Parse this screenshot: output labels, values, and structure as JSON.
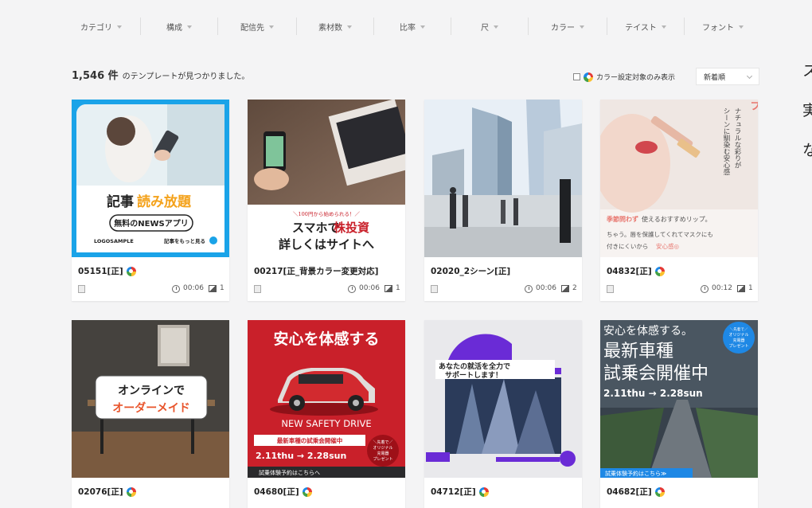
{
  "filters": [
    {
      "label": "カテゴリ"
    },
    {
      "label": "構成"
    },
    {
      "label": "配信先"
    },
    {
      "label": "素材数"
    },
    {
      "label": "比率"
    },
    {
      "label": "尺"
    },
    {
      "label": "カラー"
    },
    {
      "label": "テイスト"
    },
    {
      "label": "フォント"
    }
  ],
  "results": {
    "count": "1,546 件",
    "suffix": "のテンプレートが見つかりました。"
  },
  "color_filter": {
    "label": "カラー設定対象のみ表示",
    "checked": false
  },
  "sort": {
    "selected": "新着順"
  },
  "side_text": [
    "ス",
    "実",
    "な"
  ],
  "colors": {
    "accent": "#2196f3",
    "red": "#c9202a",
    "dark": "#222222"
  },
  "cards": [
    {
      "title": "05151[正]",
      "duration": "00:06",
      "scenes": "1",
      "has_color_icon": true,
      "thumb": {
        "headline1": "記事",
        "headline2": "読み放題",
        "badge": "無料のNEWSアプリ",
        "logo": "LOGOSAMPLE",
        "cta": "記事をもっと見る"
      }
    },
    {
      "title": "00217[正_背景カラー変更対応]",
      "duration": "00:06",
      "scenes": "1",
      "has_color_icon": false,
      "thumb": {
        "small": "＼100円から始められる！／",
        "line1a": "スマホで",
        "line1b": "株投資",
        "line2": "詳しくはサイトへ"
      }
    },
    {
      "title": "02020_2シーン[正]",
      "duration": "00:06",
      "scenes": "2",
      "has_color_icon": false,
      "thumb": {}
    },
    {
      "title": "04832[正]",
      "duration": "00:12",
      "scenes": "1",
      "has_color_icon": true,
      "thumb": {
        "red_title": "潤いリップ",
        "vert1": "ナチュラルな彩りが",
        "vert2": "シーンに馴染む安心感",
        "caption1a": "季節問わず",
        "caption1b": "使えるおすすめリップ。",
        "caption2": "ちゃう。唇を保護してくれてマスクにも",
        "caption3a": "付きにくいから",
        "caption3b": "安心感◎"
      }
    },
    {
      "title": "02076[正]",
      "duration": "",
      "scenes": "",
      "has_color_icon": true,
      "thumb": {
        "line1": "オンラインで",
        "line2": "オーダーメイド"
      }
    },
    {
      "title": "04680[正]",
      "duration": "",
      "scenes": "",
      "has_color_icon": true,
      "thumb": {
        "headline": "安心を体感する",
        "sub": "NEW SAFETY DRIVE",
        "band": "最新車種の試乗会開催中",
        "dates": "2.11thu → 2.28sun",
        "badge1": "＼先着で／",
        "badge2": "オリジナル",
        "badge3": "充電器",
        "badge4": "プレゼント",
        "footer": "試乗体験予約はこちらへ"
      }
    },
    {
      "title": "04712[正]",
      "duration": "",
      "scenes": "",
      "has_color_icon": true,
      "thumb": {
        "line1": "あなたの就活を全力で",
        "line2": "サポートします！"
      }
    },
    {
      "title": "04682[正]",
      "duration": "",
      "scenes": "",
      "has_color_icon": true,
      "thumb": {
        "line1": "安心を体感する。",
        "line2": "最新車種",
        "line3": "試乗会開催中",
        "dates": "2.11thu → 2.28sun",
        "badge1": "＼先着で／",
        "badge2": "オリジナル",
        "badge3": "充電器",
        "badge4": "プレゼント",
        "footer": "試乗体験予約はこちら≫"
      }
    }
  ]
}
